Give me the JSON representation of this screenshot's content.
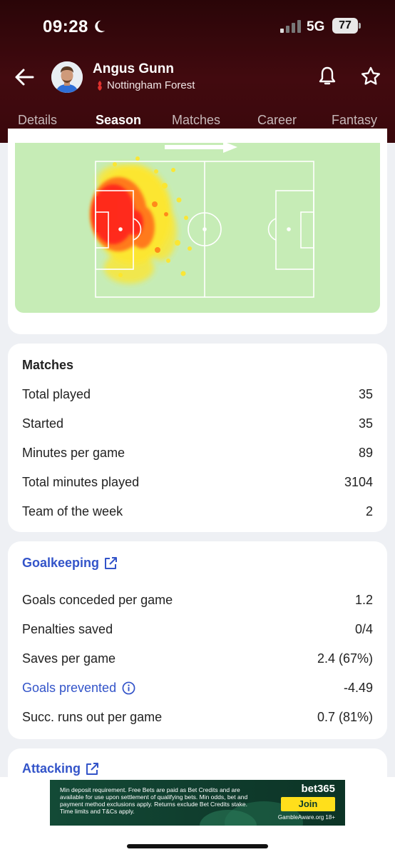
{
  "status_bar": {
    "time": "09:28",
    "network": "5G",
    "battery": "77"
  },
  "player": {
    "name": "Angus Gunn",
    "club": "Nottingham Forest"
  },
  "tabs": [
    {
      "label": "Details"
    },
    {
      "label": "Season"
    },
    {
      "label": "Matches"
    },
    {
      "label": "Career"
    },
    {
      "label": "Fantasy"
    }
  ],
  "active_tab": "Season",
  "heatmap": {
    "attack_direction": "right"
  },
  "matches": {
    "title": "Matches",
    "rows": [
      {
        "label": "Total played",
        "value": "35"
      },
      {
        "label": "Started",
        "value": "35"
      },
      {
        "label": "Minutes per game",
        "value": "89"
      },
      {
        "label": "Total minutes played",
        "value": "3104"
      },
      {
        "label": "Team of the week",
        "value": "2"
      }
    ]
  },
  "goalkeeping": {
    "title": "Goalkeeping",
    "rows": [
      {
        "label": "Goals conceded per game",
        "value": "1.2"
      },
      {
        "label": "Penalties saved",
        "value": "0/4"
      },
      {
        "label": "Saves per game",
        "value": "2.4 (67%)"
      },
      {
        "label": "Goals prevented",
        "value": "-4.49"
      },
      {
        "label": "Succ. runs out per game",
        "value": "0.7 (81%)"
      }
    ]
  },
  "attacking": {
    "title": "Attacking"
  },
  "ad": {
    "text": "Min deposit requirement. Free Bets are paid as Bet Credits and are available for use upon settlement of qualifying bets. Min odds, bet and payment method exclusions apply. Returns exclude Bet Credits stake. Time limits and T&Cs apply.",
    "brand": "bet365",
    "cta": "Join",
    "footer": "GambleAware.org 18+"
  },
  "colors": {
    "header_bg": "#420a0f",
    "link_blue": "#3354c9",
    "pitch_green": "#c6ecb6",
    "heat_red": "#ff2a1a",
    "heat_yellow": "#ffe629",
    "ad_yellow": "#ffdf1b"
  },
  "icons": [
    "moon-icon",
    "back-arrow-icon",
    "bell-icon",
    "star-icon",
    "external-link-icon",
    "info-icon",
    "club-crest-icon"
  ]
}
